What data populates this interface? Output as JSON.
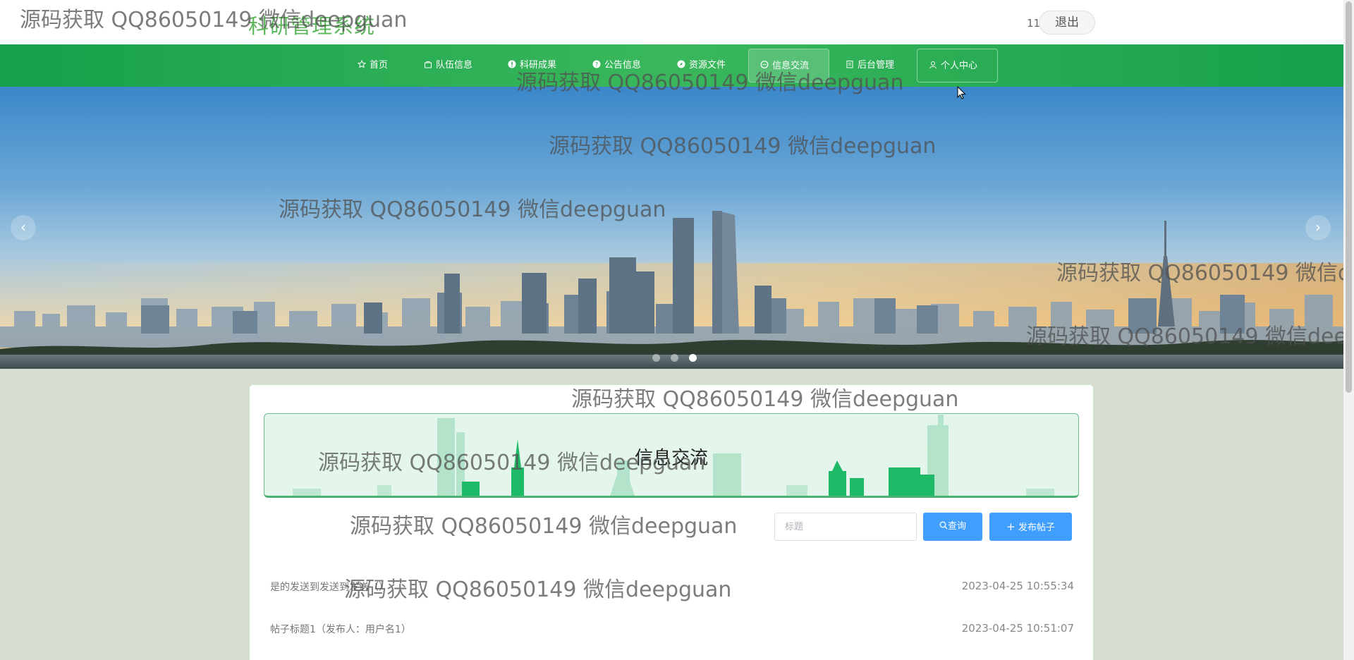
{
  "header": {
    "title": "科研管理系统",
    "username": "11",
    "logout_label": "退出"
  },
  "nav": {
    "items": [
      {
        "label": "首页",
        "icon": "star-icon"
      },
      {
        "label": "队伍信息",
        "icon": "bag-icon"
      },
      {
        "label": "科研成果",
        "icon": "info-circle-icon"
      },
      {
        "label": "公告信息",
        "icon": "question-circle-icon"
      },
      {
        "label": "资源文件",
        "icon": "compass-icon"
      },
      {
        "label": "信息交流",
        "icon": "chat-icon"
      },
      {
        "label": "后台管理",
        "icon": "document-icon"
      },
      {
        "label": "个人中心",
        "icon": "user-icon"
      }
    ],
    "active": "信息交流"
  },
  "banner": {
    "slide_count": 3,
    "active_slide": 3,
    "prev_label": "‹",
    "next_label": "›"
  },
  "section": {
    "title": "信息交流"
  },
  "search": {
    "placeholder": "标题",
    "query_label": "查询",
    "post_label": "发布帖子"
  },
  "posts": [
    {
      "title": "是的发送到发送到发送（）",
      "date": "2023-04-25 10:55:34"
    },
    {
      "title": "帖子标题1（发布人：用户名1）",
      "date": "2023-04-25 10:51:07"
    }
  ],
  "watermark": "源码获取 QQ86050149 微信deepguan",
  "colors": {
    "nav_green": "#16a04a",
    "title_green": "#5cb85c",
    "button_blue": "#409eff",
    "section_bg": "#e4f6ec"
  }
}
